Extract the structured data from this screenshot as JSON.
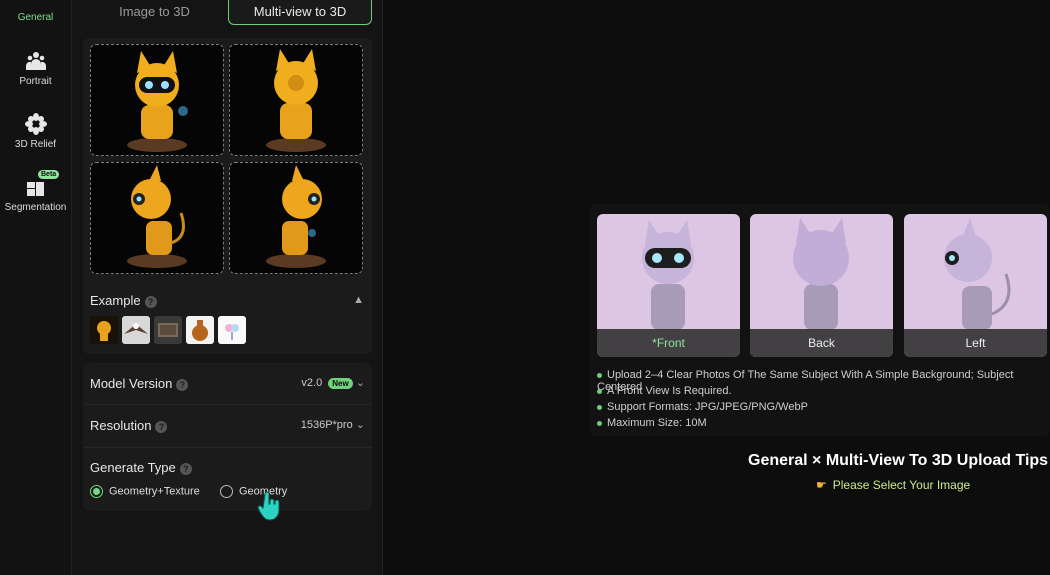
{
  "sidebar": {
    "items": [
      {
        "label": "General",
        "icon": "cube-icon",
        "active": true
      },
      {
        "label": "Portrait",
        "icon": "people-icon"
      },
      {
        "label": "3D Relief",
        "icon": "gear-flower-icon"
      },
      {
        "label": "Segmentation",
        "icon": "segment-icon",
        "badge": "Beta"
      }
    ]
  },
  "tabs": [
    {
      "label": "Image to 3D",
      "active": false
    },
    {
      "label": "Multi-view to 3D",
      "active": true
    }
  ],
  "example": {
    "label": "Example",
    "help": "?"
  },
  "settings": {
    "model_version": {
      "label": "Model Version",
      "value": "v2.0",
      "badge": "New"
    },
    "resolution": {
      "label": "Resolution",
      "value": "1536P*pro"
    },
    "generate_type": {
      "label": "Generate Type",
      "options": [
        {
          "label": "Geometry+Texture",
          "selected": true
        },
        {
          "label": "Geometry",
          "selected": false
        }
      ]
    }
  },
  "tips": {
    "views": [
      "*Front",
      "Back",
      "Left"
    ],
    "bullets": [
      "Upload 2–4 Clear Photos Of The Same Subject With A Simple Background; Subject Centered",
      "A Front View Is Required.",
      "Support Formats: JPG/JPEG/PNG/WebP",
      "Maximum Size: 10M"
    ],
    "title": "General × Multi-View To 3D Upload Tips",
    "hint": "Please Select Your Image"
  },
  "colors": {
    "accent": "#6fcf79",
    "background": "#0d0d0d",
    "panel": "#141414"
  }
}
